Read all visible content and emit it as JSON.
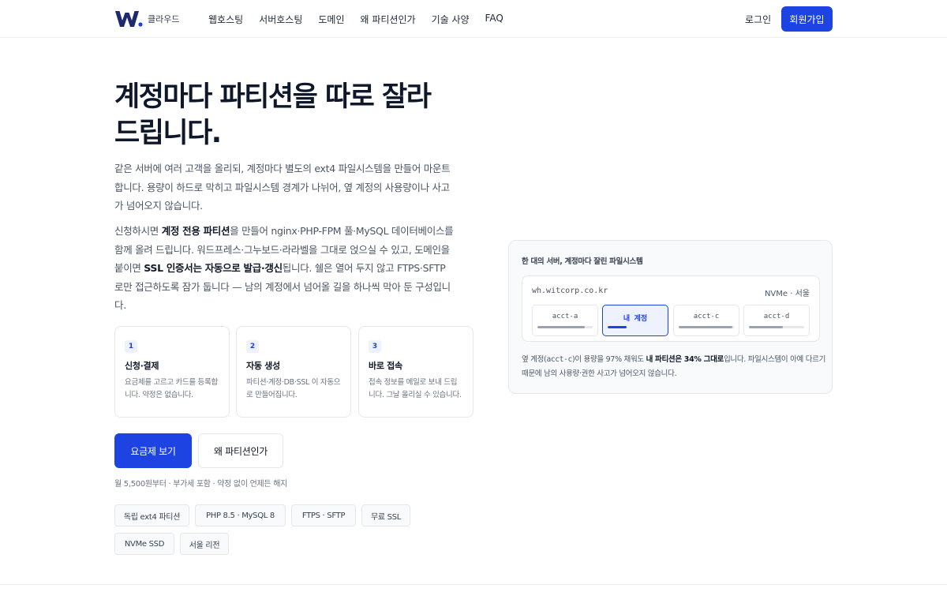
{
  "header": {
    "logo_text": "클라우드",
    "nav": [
      "웹호스팅",
      "서버호스팅",
      "도메인",
      "왜 파티션인가",
      "기술 사양",
      "FAQ"
    ],
    "login": "로그인",
    "signup": "회원가입"
  },
  "hero": {
    "headline_line1": "계정마다 파티션을 따로 잘라",
    "headline_line2": "드립니다.",
    "para1": "같은 서버에 여러 고객을 올리되, 계정마다 별도의 ext4 파일시스템을 만들어 마운트합니다. 용량이 하드로 막히고 파일시스템 경계가 나뉘어, 옆 계정의 사용량이나 사고가 넘어오지 않습니다.",
    "para2": {
      "t1": "신청하시면 ",
      "b1": "계정 전용 파티션",
      "t2": "을 만들어 nginx·PHP-FPM 풀·MySQL 데이터베이스를 함께 올려 드립니다. 워드프레스·그누보드·라라벨을 그대로 얹으실 수 있고, 도메인을 붙이면 ",
      "b2": "SSL 인증서는 자동으로 발급·갱신",
      "t3": "됩니다. 쉘은 열어 두지 않고 FTPS·SFTP 로만 접근하도록 잠가 둡니다 — 남의 계정에서 넘어올 길을 하나씩 막아 둔 구성입니다."
    }
  },
  "steps": [
    {
      "num": "1",
      "title": "신청·결제",
      "desc": "요금제를 고르고 카드를 등록합니다. 약정은 없습니다."
    },
    {
      "num": "2",
      "title": "자동 생성",
      "desc": "파티션·계정·DB·SSL 이 자동으로 만들어집니다."
    },
    {
      "num": "3",
      "title": "바로 접속",
      "desc": "접속 정보를 메일로 보내 드립니다. 그날 올리실 수 있습니다."
    }
  ],
  "cta": {
    "primary": "요금제 보기",
    "secondary": "왜 파티션인가",
    "fineprint": "월 5,500원부터 · 부가세 포함 · 약정 없이 언제든 해지"
  },
  "tags": [
    "독립 ext4 파티션",
    "PHP 8.5 · MySQL 8",
    "FTPS · SFTP",
    "무료 SSL",
    "NVMe SSD",
    "서울 리전"
  ],
  "panel": {
    "title": "한 대의 서버, 계정마다 잘린 파일시스템",
    "host": "wh.witcorp.co.kr",
    "spec": "NVMe · 서울",
    "accounts": [
      {
        "label": "acct-a",
        "usage": 0.85,
        "active": false
      },
      {
        "label": "내 계정",
        "usage": 0.34,
        "active": true
      },
      {
        "label": "acct-c",
        "usage": 0.97,
        "active": false
      },
      {
        "label": "acct-d",
        "usage": 0.62,
        "active": false
      }
    ],
    "note": {
      "t1": "옆 계정(",
      "code": "acct-c",
      "t2": ")이 용량을 97% 채워도 ",
      "b": "내 파티션은 34% 그대로",
      "t3": "입니다. 파일시스템이 아예 다르기 때문에 남의 사용량·권한 사고가 넘어오지 않습니다."
    }
  },
  "colors": {
    "accent": "#1d43e3",
    "text": "#111827",
    "muted": "#6b7280"
  }
}
